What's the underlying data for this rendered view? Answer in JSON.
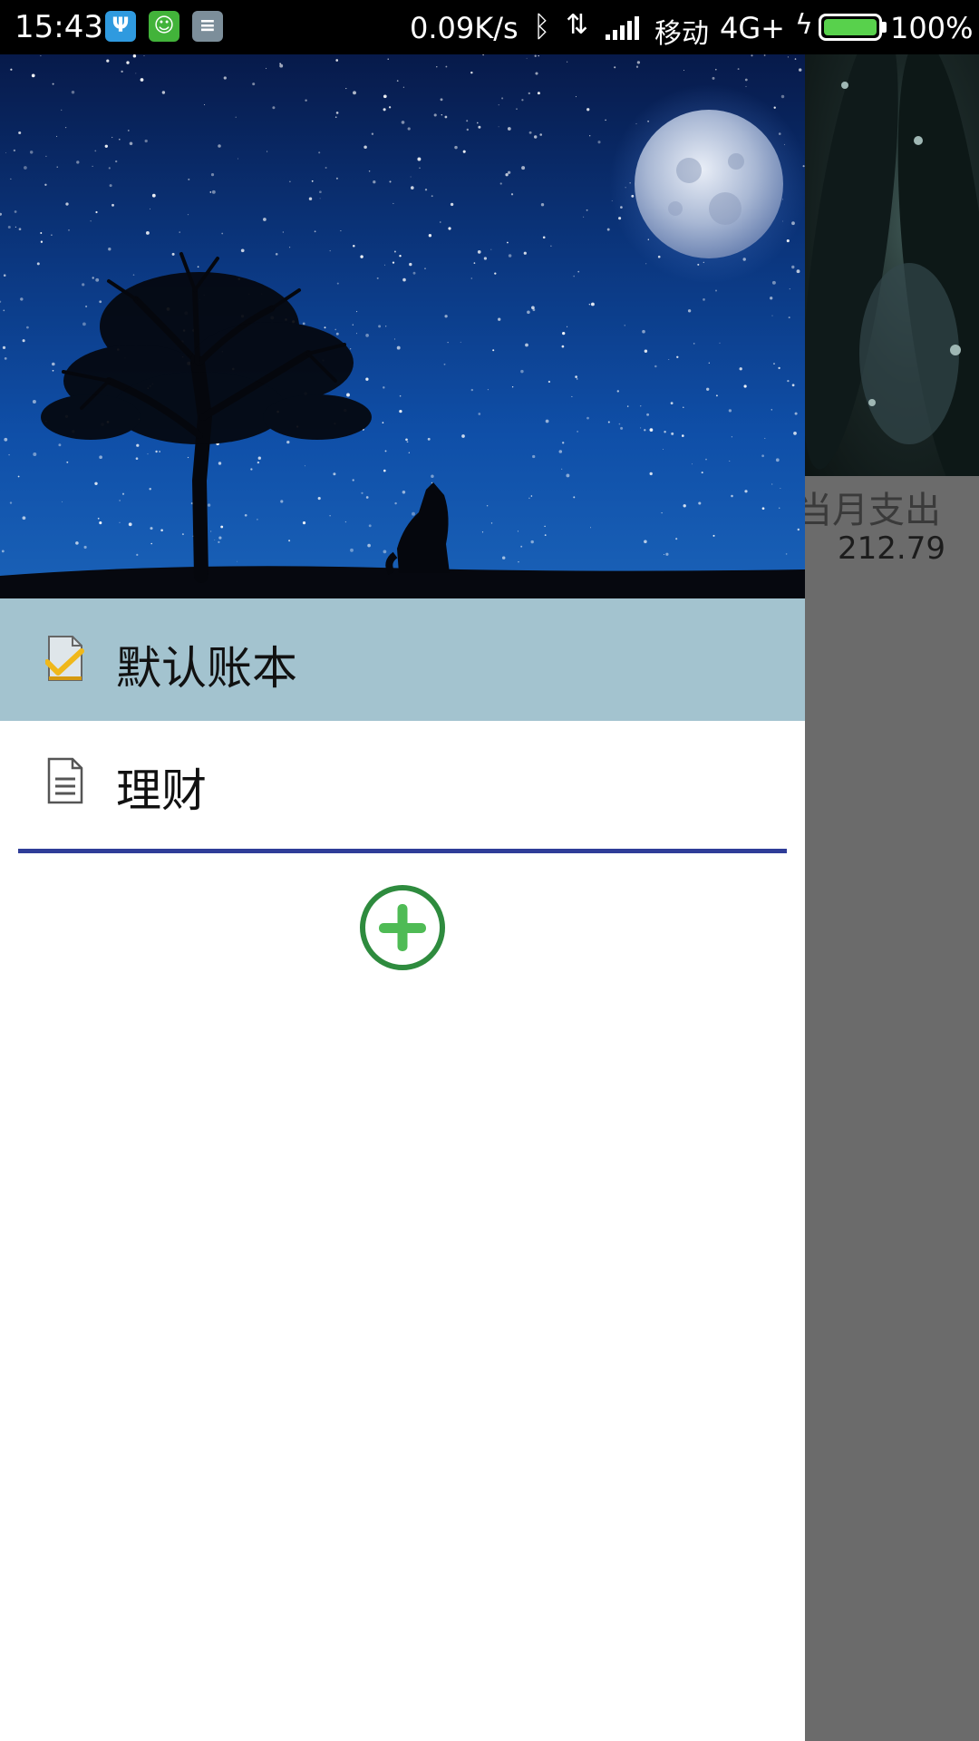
{
  "status_bar": {
    "time": "15:43",
    "net_speed": "0.09K/s",
    "carrier": "移动",
    "network": "4G+",
    "battery": "100%",
    "battery_level": 1.0,
    "icons": [
      "usb-icon",
      "android-icon",
      "notes-icon",
      "bluetooth-icon",
      "data-transfer-icon",
      "signal-icon",
      "charging-icon",
      "battery-icon"
    ]
  },
  "drawer": {
    "books": [
      {
        "label": "默认账本",
        "icon": "checked-ledger-icon",
        "selected": true
      },
      {
        "label": "理财",
        "icon": "document-icon",
        "selected": false
      }
    ],
    "add_icon": "add-circle-icon",
    "colors": {
      "selected_bg": "#a3c3cf",
      "divider": "#2f3d98",
      "add": "#2e8b3e"
    }
  },
  "main": {
    "month_expense_label": "当月支出",
    "month_expense_value": "212.79"
  }
}
